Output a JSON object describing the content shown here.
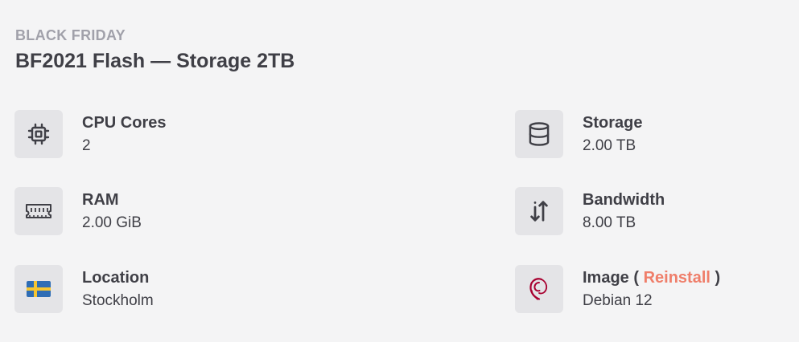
{
  "header": {
    "eyebrow": "BLACK FRIDAY",
    "title": "BF2021 Flash — Storage 2TB"
  },
  "specs": {
    "cpu": {
      "label": "CPU Cores",
      "value": "2",
      "icon": "cpu-icon"
    },
    "ram": {
      "label": "RAM",
      "value": "2.00 GiB",
      "icon": "memory-icon"
    },
    "location": {
      "label": "Location",
      "value": "Stockholm",
      "icon": "sweden-flag-icon"
    },
    "storage": {
      "label": "Storage",
      "value": "2.00 TB",
      "icon": "database-icon"
    },
    "bandwidth": {
      "label": "Bandwidth",
      "value": "8.00 TB",
      "icon": "arrows-up-down-icon"
    },
    "image": {
      "label_prefix": "Image (",
      "reinstall_label": "Reinstall",
      "label_suffix": ")",
      "value": "Debian 12",
      "icon": "debian-logo-icon"
    }
  },
  "colors": {
    "background": "#f4f4f5",
    "icon_tile": "#e4e4e7",
    "text": "#3f3f46",
    "muted": "#a1a1aa",
    "accent": "#ef7e6a"
  }
}
